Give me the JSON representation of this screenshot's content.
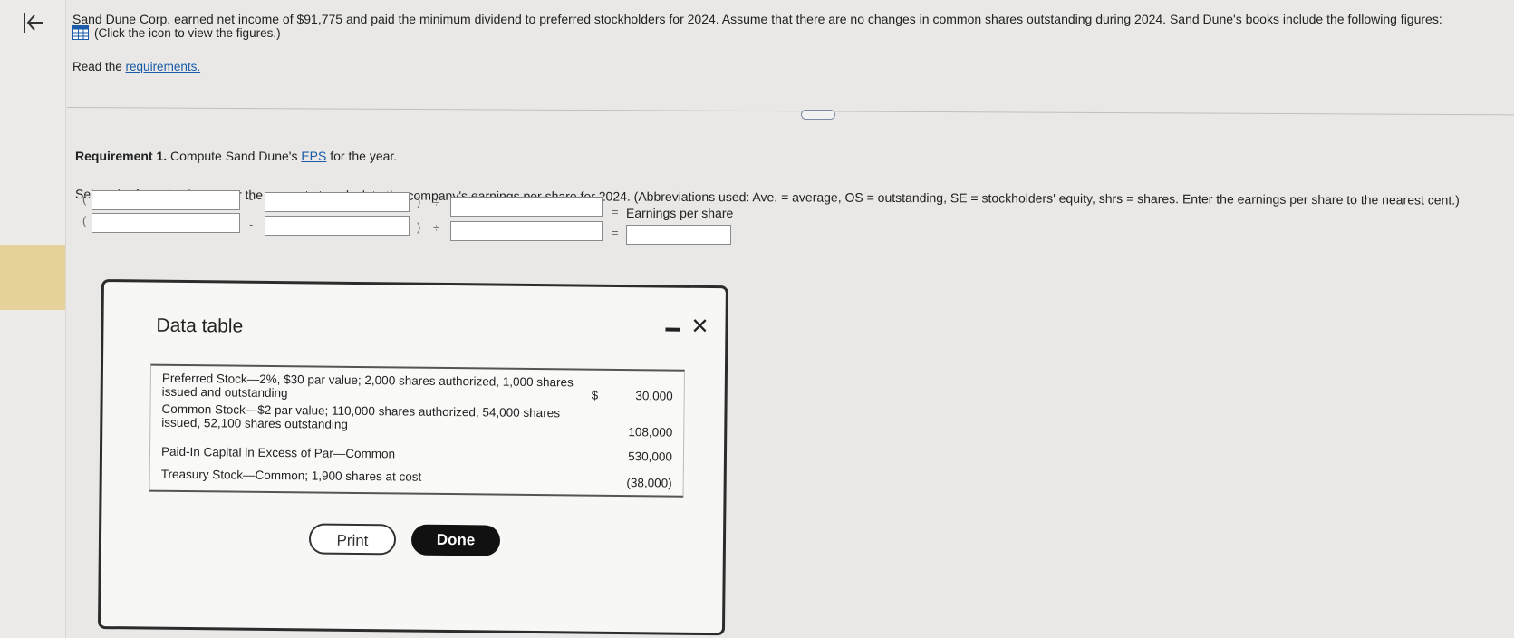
{
  "nav": {
    "back_icon": "collapse-left-icon"
  },
  "question": {
    "prompt": "Sand Dune Corp. earned net income of $91,775 and paid the minimum dividend to preferred stockholders for 2024. Assume that there are no changes in common shares outstanding during 2024. Sand Dune's books include the following figures:",
    "figures_hint": "(Click the icon to view the figures.)",
    "read_prefix": "Read the ",
    "requirements_link": "requirements."
  },
  "requirement": {
    "label": "Requirement 1.",
    "text_before": " Compute Sand Dune's ",
    "eps_link": "EPS",
    "text_after": " for the year.",
    "instruction": "Select the formula, then enter the amounts to calculate the company's earnings per share for 2024. (Abbreviations used: Ave. = average, OS = outstanding, SE = stockholders' equity, shrs = shares. Enter the earnings per share to the nearest cent.)"
  },
  "formula": {
    "open_paren": "(",
    "minus": "-",
    "close_paren": ")",
    "divide": "÷",
    "equals": "=",
    "result_label": "Earnings per share"
  },
  "modal": {
    "title": "Data table",
    "rows": [
      {
        "label": "Preferred Stock—2%, $30 par value; 2,000 shares authorized, 1,000 shares issued and outstanding",
        "currency": "$",
        "value": "30,000"
      },
      {
        "label": "Common Stock—$2 par value; 110,000 shares authorized, 54,000 shares issued, 52,100 shares outstanding",
        "currency": "",
        "value": "108,000"
      },
      {
        "label": "Paid-In Capital in Excess of Par—Common",
        "currency": "",
        "value": "530,000"
      },
      {
        "label": "Treasury Stock—Common; 1,900 shares at cost",
        "currency": "",
        "value": "(38,000)"
      }
    ],
    "print_label": "Print",
    "done_label": "Done"
  }
}
